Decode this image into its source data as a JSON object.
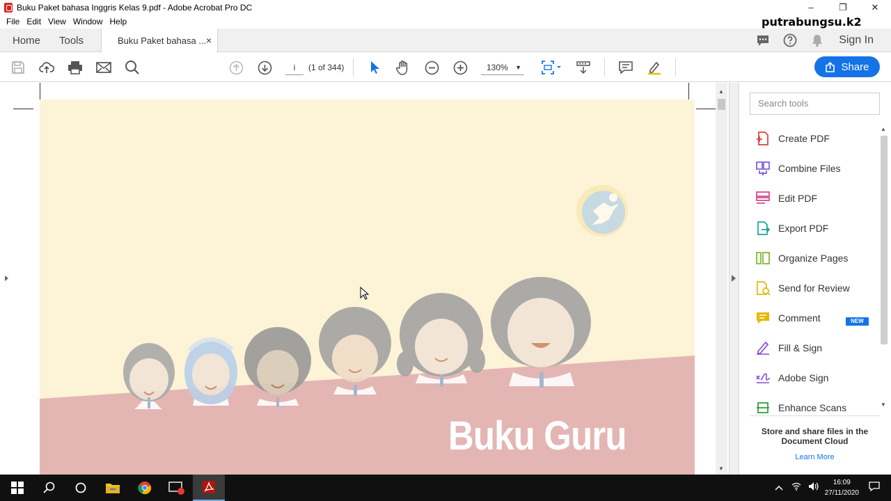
{
  "window": {
    "title": "Buku Paket bahasa Inggris Kelas 9.pdf - Adobe Acrobat Pro DC",
    "controls": [
      "–",
      "❐",
      "✕"
    ]
  },
  "menu": [
    "File",
    "Edit",
    "View",
    "Window",
    "Help"
  ],
  "watermark": "putrabungsu.k2",
  "tabs": {
    "home": "Home",
    "tools": "Tools",
    "doc": "Buku Paket bahasa ...",
    "close": "×"
  },
  "header": {
    "sign_in": "Sign In"
  },
  "toolbar": {
    "page_input": "i",
    "page_count": "(1 of 344)",
    "zoom": "130%",
    "zoom_caret": "▼"
  },
  "share": {
    "label": "Share"
  },
  "document": {
    "title_text": "Buku Guru",
    "background": "#fdf3d6",
    "band_color": "#e4b6b3"
  },
  "tools_panel": {
    "search_placeholder": "Search tools",
    "items": [
      {
        "label": "Create PDF",
        "icon": "create-pdf-icon",
        "color": "#d9403a"
      },
      {
        "label": "Combine Files",
        "icon": "combine-files-icon",
        "color": "#7a5ad8"
      },
      {
        "label": "Edit PDF",
        "icon": "edit-pdf-icon",
        "color": "#d9408a"
      },
      {
        "label": "Export PDF",
        "icon": "export-pdf-icon",
        "color": "#1ba39c"
      },
      {
        "label": "Organize Pages",
        "icon": "organize-pages-icon",
        "color": "#7ab82a"
      },
      {
        "label": "Send for Review",
        "icon": "send-review-icon",
        "color": "#e6b800"
      },
      {
        "label": "Comment",
        "icon": "comment-icon",
        "color": "#e6b800"
      },
      {
        "label": "Fill & Sign",
        "icon": "fill-sign-icon",
        "color": "#8a4ad8"
      },
      {
        "label": "Adobe Sign",
        "icon": "adobe-sign-icon",
        "color": "#8a4ad8"
      },
      {
        "label": "Enhance Scans",
        "icon": "enhance-scans-icon",
        "color": "#2a9d3a"
      }
    ],
    "new_badge": "NEW",
    "cloud_title": "Store and share files in the Document Cloud",
    "cloud_link": "Learn More"
  },
  "taskbar": {
    "time": "16:09",
    "date": "27/11/2020"
  },
  "colors": {
    "accent": "#1473e6",
    "taskbar": "#101010"
  }
}
